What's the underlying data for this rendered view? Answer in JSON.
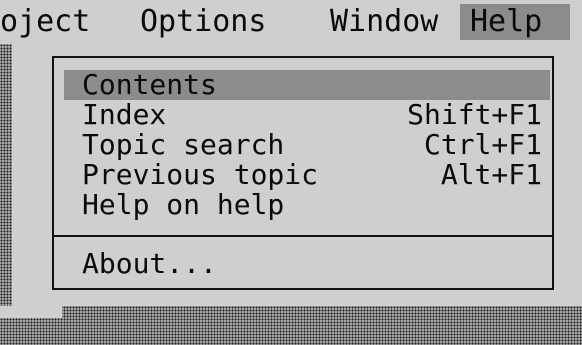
{
  "menubar": {
    "items": [
      {
        "label": "oject"
      },
      {
        "label": "Options"
      },
      {
        "label": "Window"
      },
      {
        "label": "Help"
      }
    ]
  },
  "help_menu": {
    "items": [
      {
        "label": "Contents",
        "accel": ""
      },
      {
        "label": "Index",
        "accel": "Shift+F1"
      },
      {
        "label": "Topic search",
        "accel": "Ctrl+F1"
      },
      {
        "label": "Previous topic",
        "accel": "Alt+F1"
      },
      {
        "label": "Help on help",
        "accel": ""
      }
    ],
    "about": {
      "label": "About..."
    }
  },
  "colors": {
    "background": "#cfcfcf",
    "highlight": "#8c8c8c",
    "text": "#0a0a0a"
  }
}
